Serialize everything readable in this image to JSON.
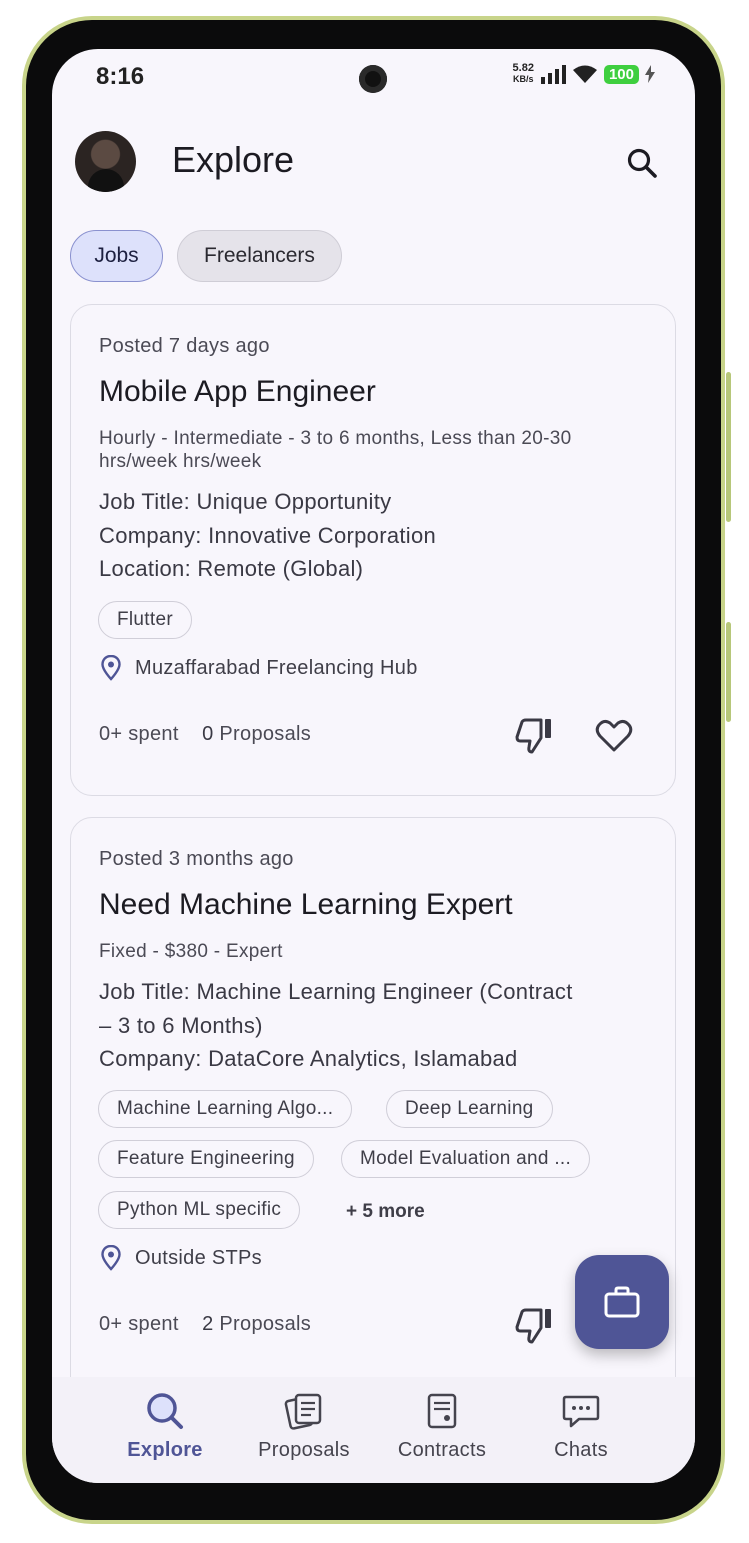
{
  "status_bar": {
    "time": "8:16",
    "net_speed_value": "5.82",
    "net_speed_unit": "KB/s",
    "battery": "100"
  },
  "header": {
    "title": "Explore"
  },
  "segments": [
    {
      "label": "Jobs",
      "selected": true
    },
    {
      "label": "Freelancers",
      "selected": false
    }
  ],
  "jobs": [
    {
      "posted": "Posted 7 days ago",
      "title": "Mobile App Engineer",
      "meta": "Hourly - Intermediate - 3 to 6 months, Less than 20-30 hrs/week hrs/week",
      "description": [
        "Job Title: Unique Opportunity",
        "Company: Innovative Corporation",
        "Location: Remote (Global)"
      ],
      "skills": [
        "Flutter"
      ],
      "location": "Muzaffarabad Freelancing Hub",
      "spent": "0+ spent",
      "proposals_count": "0",
      "proposals_label": "Proposals"
    },
    {
      "posted": "Posted 3 months ago",
      "title": "Need Machine Learning Expert",
      "meta": "Fixed - $380 - Expert",
      "description": [
        "Job Title: Machine Learning Engineer (Contract",
        "– 3 to 6 Months)",
        "Company: DataCore Analytics, Islamabad"
      ],
      "skills": [
        "Machine Learning Algo...",
        "Deep Learning",
        "Feature Engineering",
        "Model Evaluation and ...",
        "Python ML specific"
      ],
      "more_skills": "+ 5 more",
      "location": "Outside STPs",
      "spent": "0+ spent",
      "proposals_count": "2",
      "proposals_label": "Proposals"
    }
  ],
  "bottom_nav": [
    {
      "label": "Explore",
      "icon": "search-icon",
      "active": true
    },
    {
      "label": "Proposals",
      "icon": "proposals-icon",
      "active": false
    },
    {
      "label": "Contracts",
      "icon": "contract-icon",
      "active": false
    },
    {
      "label": "Chats",
      "icon": "chat-icon",
      "active": false
    }
  ],
  "colors": {
    "accent": "#4f5596",
    "selected_chip_bg": "#dde1fb",
    "background": "#f8f6fc"
  }
}
